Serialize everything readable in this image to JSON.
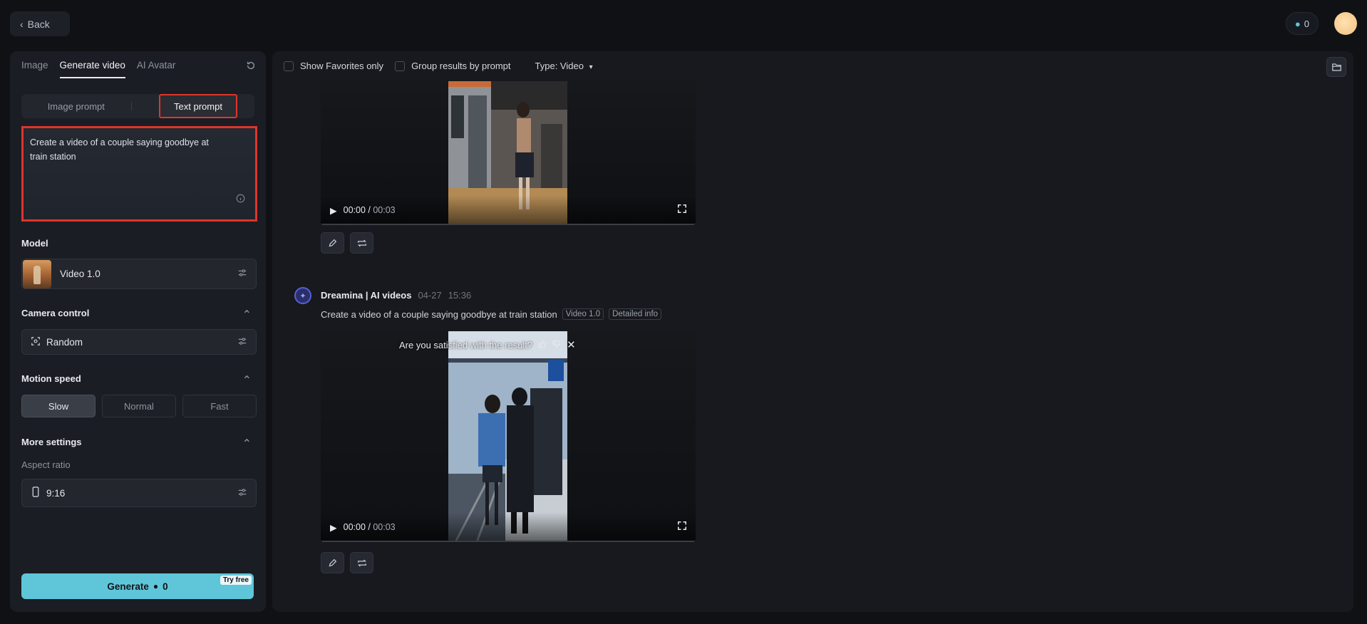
{
  "topbar": {
    "back_label": "Back",
    "credits": "0"
  },
  "left": {
    "tabs": [
      "Image",
      "Generate video",
      "AI Avatar"
    ],
    "prompt_modes": [
      "Image prompt",
      "Text prompt"
    ],
    "prompt_text": "Create a video of a couple saying goodbye at train station",
    "model_label": "Model",
    "model_value": "Video 1.0",
    "camera_label": "Camera control",
    "camera_value": "Random",
    "motion_label": "Motion speed",
    "motion_options": [
      "Slow",
      "Normal",
      "Fast"
    ],
    "motion_selected": "Slow",
    "more_label": "More settings",
    "aspect_label": "Aspect ratio",
    "aspect_value": "9:16",
    "generate_label": "Generate",
    "generate_cost": "0",
    "try_free": "Try free"
  },
  "filters": {
    "favorites": "Show Favorites only",
    "group": "Group results by prompt",
    "type": "Type: Video"
  },
  "results": [
    {
      "time_current": "00:00",
      "time_total": "00:03"
    },
    {
      "author": "Dreamina | AI videos",
      "date": "04-27",
      "time": "15:36",
      "prompt": "Create a video of a couple saying goodbye at train station",
      "model_tag": "Video 1.0",
      "info_tag": "Detailed info",
      "survey": "Are you satisfied with the result?",
      "time_current": "00:00",
      "time_total": "00:03"
    }
  ]
}
